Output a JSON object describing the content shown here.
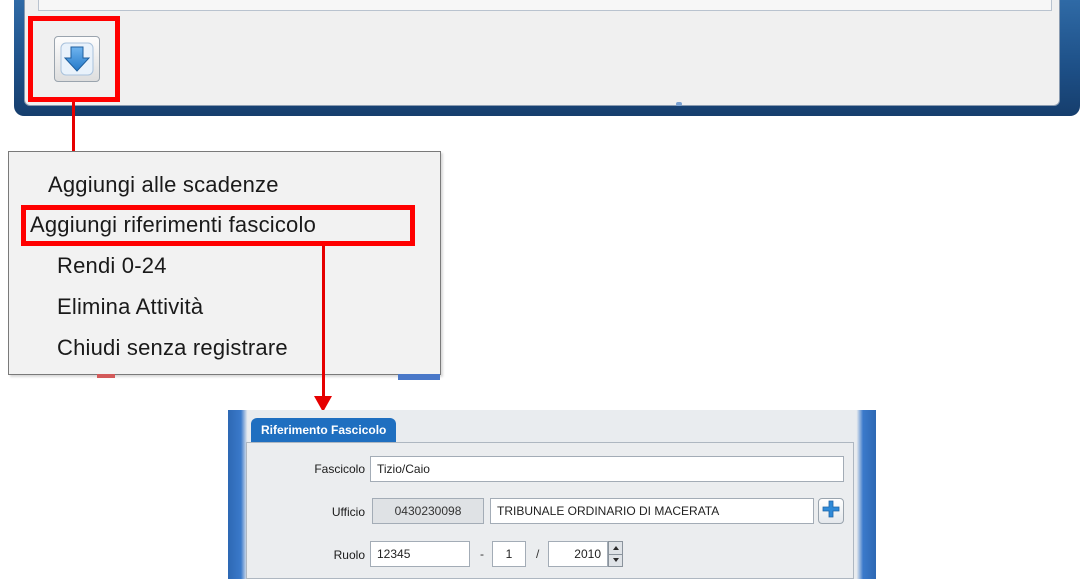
{
  "menu": {
    "items": [
      {
        "label": "Aggiungi alle scadenze"
      },
      {
        "label": "Aggiungi riferimenti fascicolo"
      },
      {
        "label": "Rendi 0-24"
      },
      {
        "label": "Elimina Attività"
      },
      {
        "label": "Chiudi senza registrare"
      }
    ],
    "highlighted_index": 1
  },
  "toolbar": {
    "menu_button_icon": "download-arrow-icon"
  },
  "form": {
    "tab_label": "Riferimento Fascicolo",
    "fascicolo": {
      "label": "Fascicolo",
      "value": "Tizio/Caio"
    },
    "ufficio": {
      "label": "Ufficio",
      "code": "0430230098",
      "name": "TRIBUNALE ORDINARIO DI MACERATA"
    },
    "ruolo": {
      "label": "Ruolo",
      "number": "12345",
      "sep1": "-",
      "part": "1",
      "sep2": "/",
      "year": "2010"
    }
  },
  "colors": {
    "highlight_red": "#ff0000",
    "tab_blue": "#1f6fc0",
    "icon_blue": "#2f8ad8",
    "window_frame": "#1d4f86"
  }
}
